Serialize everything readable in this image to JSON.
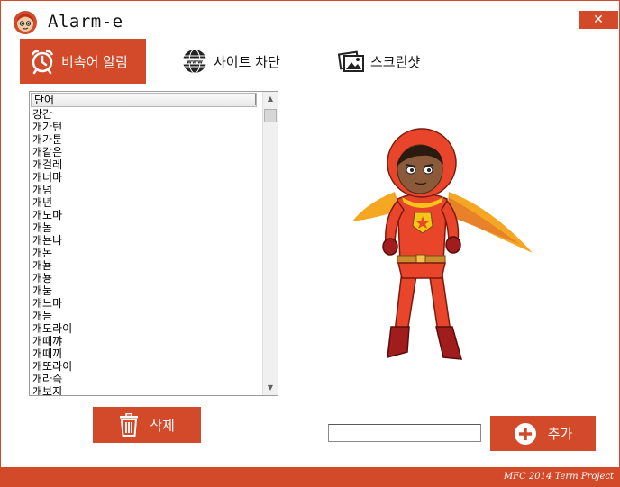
{
  "app": {
    "title": "Alarm-e",
    "close_label": "✕"
  },
  "tabs": [
    {
      "label": "비속어 알림",
      "icon": "alarm-clock-icon",
      "active": true
    },
    {
      "label": "사이트 차단",
      "icon": "www-globe-icon",
      "active": false
    },
    {
      "label": "스크린샷",
      "icon": "screenshot-picture-icon",
      "active": false
    }
  ],
  "word_list": {
    "column_header": "단어",
    "items": [
      "강간",
      "개가턴",
      "개가툰",
      "개같은",
      "개걸레",
      "개너마",
      "개넘",
      "개년",
      "개노마",
      "개놈",
      "개뇬나",
      "개논",
      "개뇸",
      "개뇽",
      "개눔",
      "개느마",
      "개늠",
      "개도라이",
      "개때꺄",
      "개때끼",
      "개또라이",
      "개라슥",
      "개보지"
    ]
  },
  "buttons": {
    "delete_label": "삭제",
    "add_label": "추가"
  },
  "add_input": {
    "value": ""
  },
  "footer": {
    "credit": "MFC 2014 Term Project"
  },
  "colors": {
    "accent": "#d24a2a",
    "hero_suit": "#e8452a",
    "cape": "#f5a623"
  }
}
